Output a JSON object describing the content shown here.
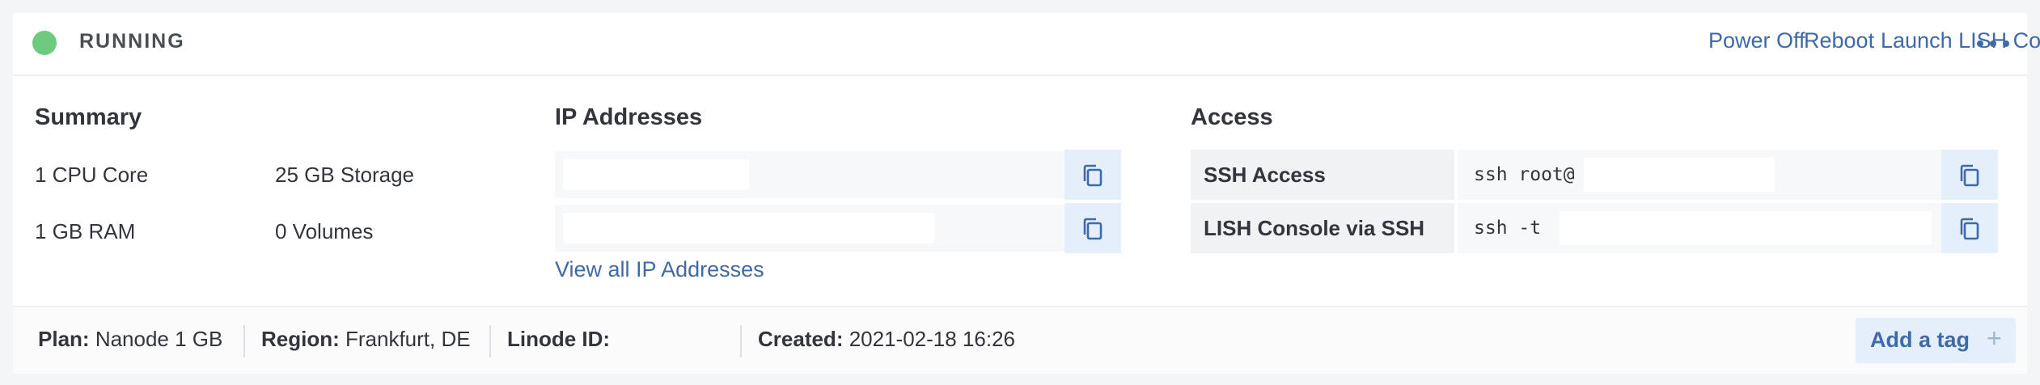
{
  "status": {
    "label": "RUNNING",
    "color": "#6ccb7d"
  },
  "header_actions": {
    "power_off": "Power Off",
    "reboot": "Reboot",
    "launch_lish": "Launch LISH Console",
    "more_icon": "more-horizontal-icon"
  },
  "summary": {
    "title": "Summary",
    "cpu": "1 CPU Core",
    "storage": "25 GB Storage",
    "ram": "1 GB RAM",
    "volumes": "0 Volumes"
  },
  "ip_addresses": {
    "title": "IP Addresses",
    "view_all": "View all IP Addresses",
    "copy_icon": "copy-icon"
  },
  "access": {
    "title": "Access",
    "rows": [
      {
        "label": "SSH Access",
        "value": "ssh root@"
      },
      {
        "label": "LISH Console via SSH",
        "value": "ssh -t"
      }
    ]
  },
  "footer": {
    "plan_label": "Plan:",
    "plan_value": "Nanode 1 GB",
    "region_label": "Region:",
    "region_value": "Frankfurt, DE",
    "linode_id_label": "Linode ID:",
    "created_label": "Created:",
    "created_value": "2021-02-18 16:26",
    "add_tag": "Add a tag",
    "add_tag_icon": "plus-icon"
  },
  "colors": {
    "accent": "#3e6aa7",
    "running": "#6ccb7d",
    "copy_button_bg": "#e4effb"
  }
}
